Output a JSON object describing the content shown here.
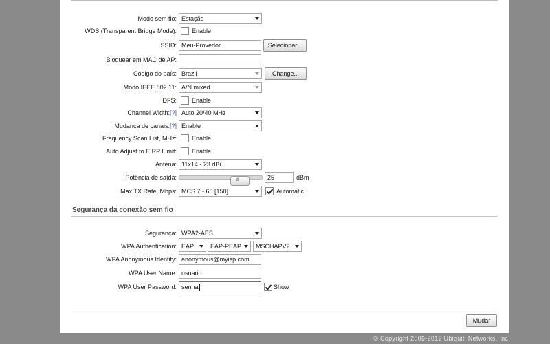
{
  "wireless": {
    "mode": {
      "label": "Modo sem fio:",
      "value": "Estação"
    },
    "wds": {
      "label": "WDS (Transparent Bridge Mode):",
      "checkbox_label": "Enable",
      "checked": false
    },
    "ssid": {
      "label": "SSID:",
      "value": "Meu-Provedor",
      "button": "Selecionar..."
    },
    "ap_mac": {
      "label": "Bloquear em MAC de AP:",
      "value": ""
    },
    "country": {
      "label": "Código do país:",
      "value": "Brazil",
      "button": "Change..."
    },
    "ieee_mode": {
      "label": "Modo IEEE 802.11:",
      "value": "A/N mixed"
    },
    "dfs": {
      "label": "DFS:",
      "checkbox_label": "Enable",
      "checked": false
    },
    "channel_width": {
      "label": "Channel Width:",
      "help": "[?]",
      "value": "Auto 20/40 MHz"
    },
    "channel_shift": {
      "label": "Mudança de canais:",
      "help": "[?]",
      "value": "Enable"
    },
    "freq_scan": {
      "label": "Frequency Scan List, MHz:",
      "checkbox_label": "Enable",
      "checked": false
    },
    "eirp": {
      "label": "Auto Adjust to EIRP Limit:",
      "checkbox_label": "Enable",
      "checked": false
    },
    "antenna": {
      "label": "Antena:",
      "value": "11x14 - 23 dBi"
    },
    "output_power": {
      "label": "Potência de saída:",
      "value": "25",
      "unit": "dBm",
      "slider_fraction": 0.8
    },
    "max_tx": {
      "label": "Max TX Rate, Mbps:",
      "value": "MCS 7 - 65 [150]",
      "checkbox_label": "Automatic",
      "checked": true
    }
  },
  "security": {
    "title": "Segurança da conexão sem fio",
    "security": {
      "label": "Segurança:",
      "value": "WPA2-AES"
    },
    "auth": {
      "label": "WPA Authentication:",
      "values": [
        "EAP",
        "EAP-PEAP",
        "MSCHAPV2"
      ]
    },
    "anon_identity": {
      "label": "WPA Anonymous Identity:",
      "value": "anonymous@myisp.com"
    },
    "user_name": {
      "label": "WPA User Name:",
      "value": "usuario"
    },
    "password": {
      "label": "WPA User Password:",
      "value": "senha",
      "checkbox_label": "Show",
      "checked": true
    }
  },
  "actions": {
    "save": "Mudar"
  },
  "footer": {
    "copyright": "© Copyright 2006-2012 Ubiquiti Networks, Inc."
  }
}
